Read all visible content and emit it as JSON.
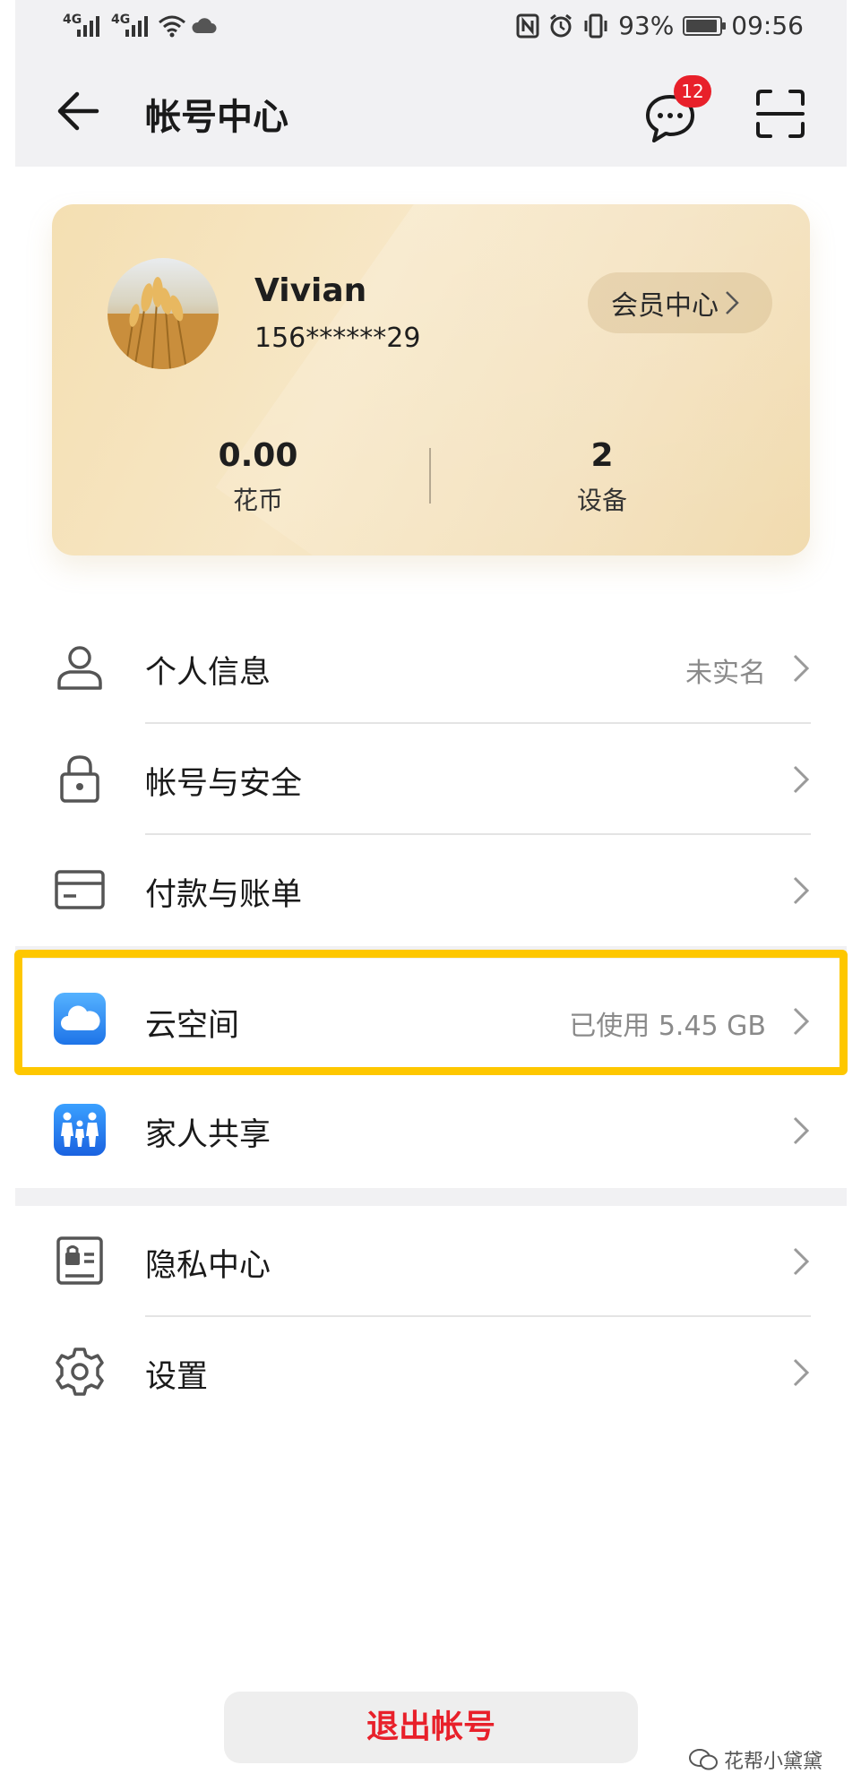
{
  "status_bar": {
    "signal_1": "4G",
    "signal_2": "4G",
    "battery": "93%",
    "battery_level": 0.93,
    "time": "09:56",
    "icons": [
      "wifi-icon",
      "cloud-icon",
      "nfc-icon",
      "alarm-icon",
      "vibrate-icon",
      "battery-icon"
    ]
  },
  "app_bar": {
    "title": "帐号中心",
    "message_badge": "12"
  },
  "card": {
    "name": "Vivian",
    "phone": "156******29",
    "vip_label": "会员中心",
    "coins_value": "0.00",
    "coins_label": "花币",
    "devices_value": "2",
    "devices_label": "设备"
  },
  "list": {
    "personal": {
      "label": "个人信息",
      "value": "未实名"
    },
    "security": {
      "label": "帐号与安全"
    },
    "payment": {
      "label": "付款与账单"
    },
    "cloud": {
      "label": "云空间",
      "value": "已使用 5.45 GB"
    },
    "family": {
      "label": "家人共享"
    },
    "privacy": {
      "label": "隐私中心"
    },
    "settings": {
      "label": "设置"
    }
  },
  "logout_label": "退出帐号",
  "watermark": "花帮小黛黛",
  "colors": {
    "accent_red": "#e8202a",
    "highlight": "#fec700",
    "cloud_blue": "#2f8cf3"
  }
}
